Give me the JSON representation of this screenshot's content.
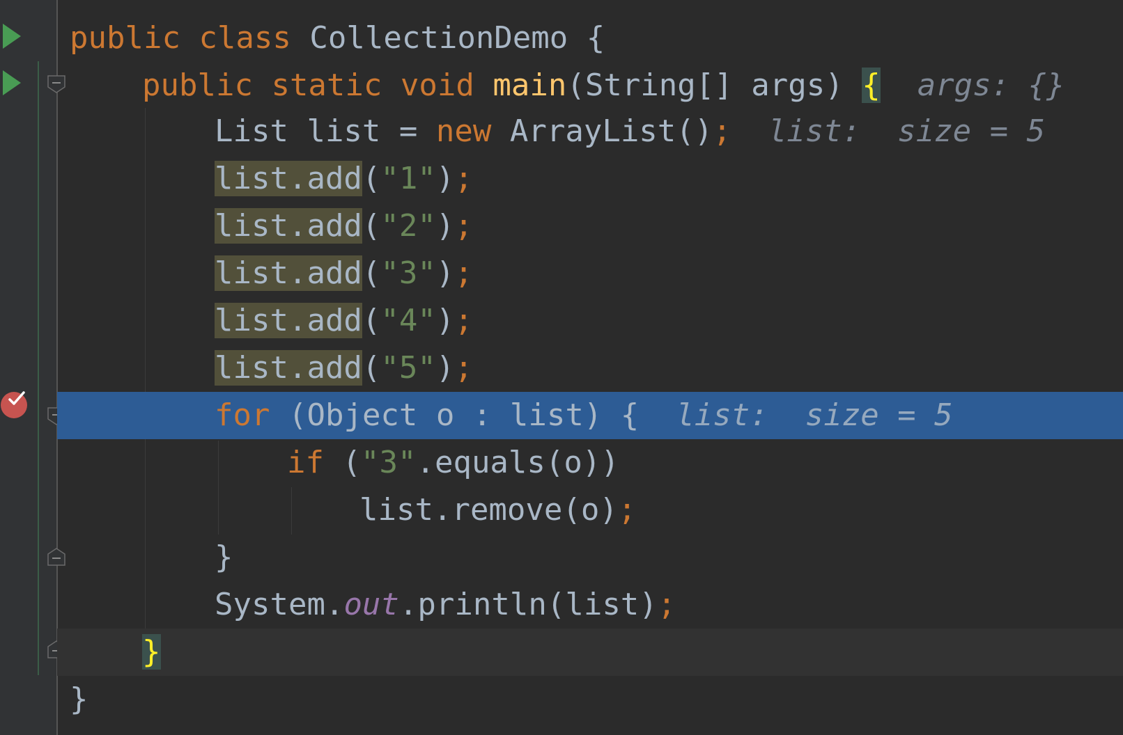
{
  "editor": {
    "lines": [
      {
        "id": "l1",
        "tokens": [
          "public",
          "class",
          "CollectionDemo",
          "{"
        ]
      },
      {
        "id": "l2",
        "tokens": [
          "public",
          "static",
          "void",
          "main",
          "(String[] args)",
          "{",
          "args:",
          "{}"
        ]
      },
      {
        "id": "l3",
        "tokens": [
          "List list = ",
          "new",
          "ArrayList()",
          ";",
          "list:",
          "size = 5"
        ]
      },
      {
        "id": "l4",
        "tokens": [
          "list.add",
          "(",
          "\"1\"",
          ")",
          ";"
        ]
      },
      {
        "id": "l5",
        "tokens": [
          "list.add",
          "(",
          "\"2\"",
          ")",
          ";"
        ]
      },
      {
        "id": "l6",
        "tokens": [
          "list.add",
          "(",
          "\"3\"",
          ")",
          ";"
        ]
      },
      {
        "id": "l7",
        "tokens": [
          "list.add",
          "(",
          "\"4\"",
          ")",
          ";"
        ]
      },
      {
        "id": "l8",
        "tokens": [
          "list.add",
          "(",
          "\"5\"",
          ")",
          ";"
        ]
      },
      {
        "id": "l9",
        "tokens": [
          "for",
          "(Object o : list) {",
          "list:",
          "size = 5"
        ]
      },
      {
        "id": "l10",
        "tokens": [
          "if",
          "(",
          "\"3\"",
          ".equals(o))"
        ]
      },
      {
        "id": "l11",
        "tokens": [
          "list.remove(o)",
          ";"
        ]
      },
      {
        "id": "l12",
        "tokens": [
          "}"
        ]
      },
      {
        "id": "l13",
        "tokens": [
          "System.",
          "out",
          ".println(list)",
          ";"
        ]
      },
      {
        "id": "l14",
        "tokens": [
          "}"
        ]
      },
      {
        "id": "l15",
        "tokens": [
          "}"
        ]
      }
    ]
  },
  "colors": {
    "background": "#2b2b2b",
    "gutter": "#313335",
    "keyword": "#cc7832",
    "method": "#ffc66d",
    "string": "#6a8759",
    "field": "#9876aa",
    "text": "#a9b7c6",
    "execution_line": "#2d5c95",
    "breakpoint": "#c75450",
    "run_icon": "#499c54"
  },
  "icons": {
    "run": "run-gutter-icon",
    "fold": "fold-icon",
    "breakpoint": "breakpoint-verified-icon"
  }
}
